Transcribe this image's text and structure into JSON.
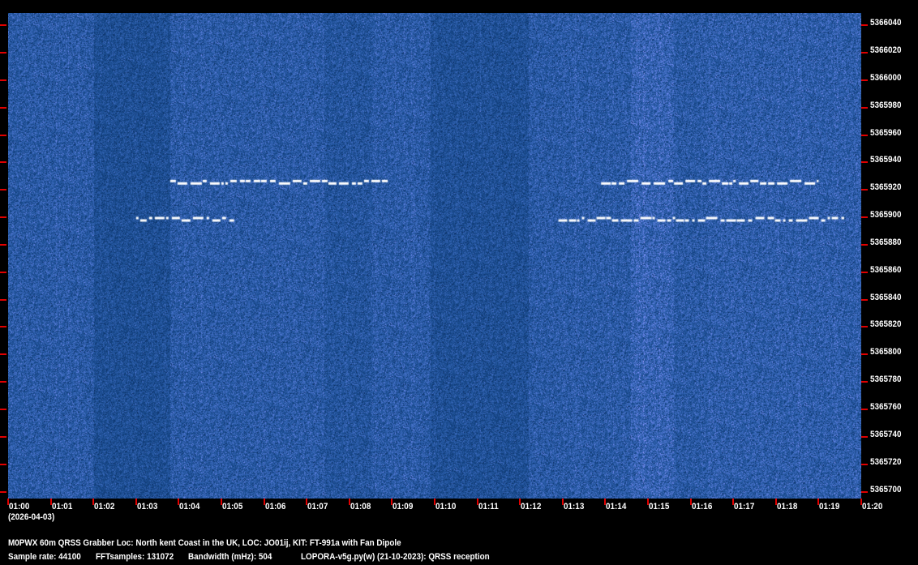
{
  "chart_data": {
    "type": "heatmap",
    "title": "M0PWX 60m QRSS Grabber Loc: North kent Coast in the UK, LOC: JO01ij, KIT: FT-991a with Fan Dipole",
    "x_ticks": [
      "01:00",
      "01:01",
      "01:02",
      "01:03",
      "01:04",
      "01:05",
      "01:06",
      "01:07",
      "01:08",
      "01:09",
      "01:10",
      "01:11",
      "01:12",
      "01:13",
      "01:14",
      "01:15",
      "01:16",
      "01:17",
      "01:18",
      "01:19",
      "01:20"
    ],
    "x_date": "(2026-04-03)",
    "xlim_minutes": [
      0,
      20
    ],
    "y_ticks": [
      5366040,
      5366020,
      5366000,
      5365980,
      5365960,
      5365940,
      5365920,
      5365900,
      5365880,
      5365860,
      5365840,
      5365820,
      5365800,
      5365780,
      5365760,
      5365740,
      5365720,
      5365700
    ],
    "ylim_hz": [
      5365695,
      5366049
    ],
    "signals": [
      {
        "freq_hz": 5365925,
        "start_min": 3.8,
        "end_min": 8.9
      },
      {
        "freq_hz": 5365898,
        "start_min": 3.0,
        "end_min": 5.3
      },
      {
        "freq_hz": 5365925,
        "start_min": 13.9,
        "end_min": 19.0
      },
      {
        "freq_hz": 5365898,
        "start_min": 12.9,
        "end_min": 19.6
      }
    ],
    "colors": {
      "background": "#0a2a66",
      "signal": "#ffffff",
      "tick": "#e00000"
    }
  },
  "footer": {
    "line1": "M0PWX 60m QRSS Grabber Loc: North kent Coast in the UK, LOC: JO01ij, KIT: FT-991a with Fan Dipole",
    "sample_rate": "Sample rate: 44100",
    "fft_samples": "FFTsamples: 131072",
    "bandwidth": "Bandwidth (mHz): 504",
    "software": "LOPORA-v5g.py(w) (21-10-2023): QRSS reception"
  }
}
